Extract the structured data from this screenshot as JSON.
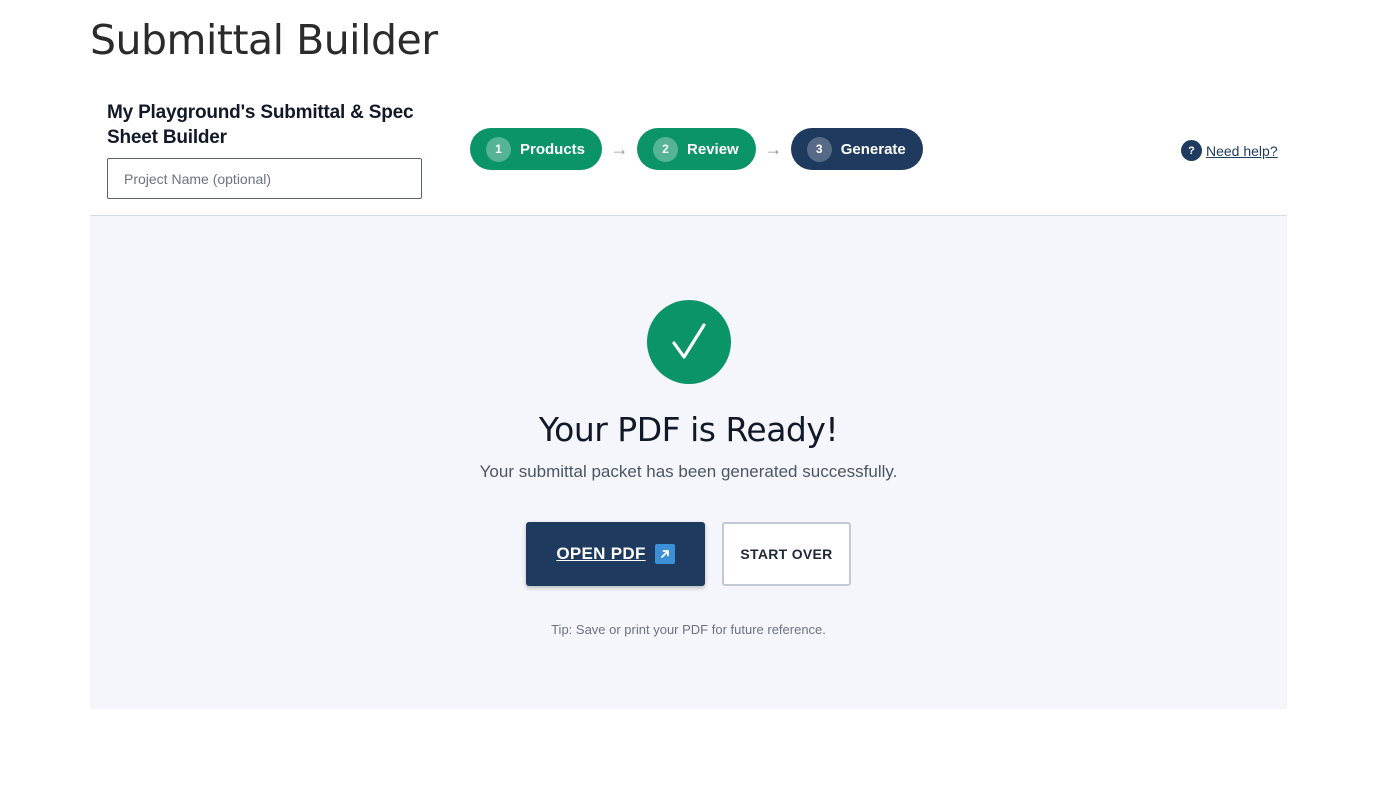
{
  "page": {
    "title": "Submittal Builder"
  },
  "header": {
    "builder_title": "My Playground's Submittal & Spec Sheet Builder",
    "project_input": {
      "placeholder": "Project Name (optional)",
      "value": ""
    },
    "steps": [
      {
        "number": "1",
        "label": "Products",
        "state": "done"
      },
      {
        "number": "2",
        "label": "Review",
        "state": "done"
      },
      {
        "number": "3",
        "label": "Generate",
        "state": "current"
      }
    ],
    "step_arrow": "→",
    "help": {
      "icon": "?",
      "label": "Need help?"
    }
  },
  "main": {
    "check_icon": "check-icon",
    "title": "Your PDF is Ready!",
    "subtitle": "Your submittal packet has been generated successfully.",
    "open_pdf_label": "OPEN PDF",
    "start_over_label": "START OVER",
    "tip": "Tip: Save or print your PDF for future reference."
  },
  "colors": {
    "green": "#0b9467",
    "navy": "#1f3a5f",
    "panel_bg": "#f4f6fb",
    "link_blue": "#3d8fd6"
  }
}
